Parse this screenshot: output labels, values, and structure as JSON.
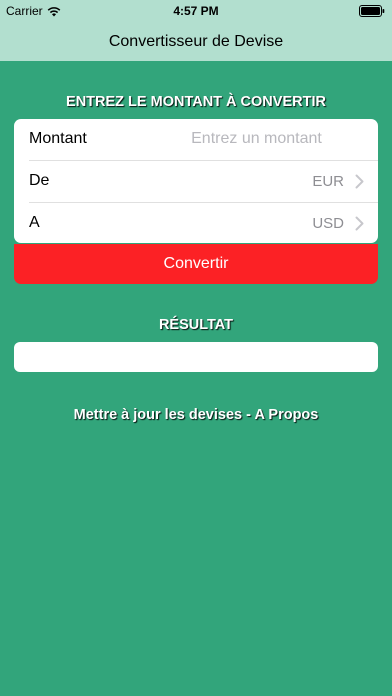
{
  "status_bar": {
    "carrier": "Carrier",
    "time": "4:57 PM",
    "wifi_icon": "wifi-icon",
    "battery_icon": "battery-icon"
  },
  "nav": {
    "title": "Convertisseur de Devise"
  },
  "form": {
    "section_title": "ENTREZ LE MONTANT À CONVERTIR",
    "amount": {
      "label": "Montant",
      "placeholder": "Entrez un montant",
      "value": ""
    },
    "from": {
      "label": "De",
      "value": "EUR"
    },
    "to": {
      "label": "A",
      "value": "USD"
    },
    "convert_label": "Convertir"
  },
  "result": {
    "section_title": "RÉSULTAT",
    "value": ""
  },
  "links": {
    "update": "Mettre à jour les devises",
    "separator": " - ",
    "about": "A Propos"
  },
  "colors": {
    "background": "#32a57b",
    "nav_background": "#b2dfcf",
    "convert_button": "#fc2125"
  }
}
